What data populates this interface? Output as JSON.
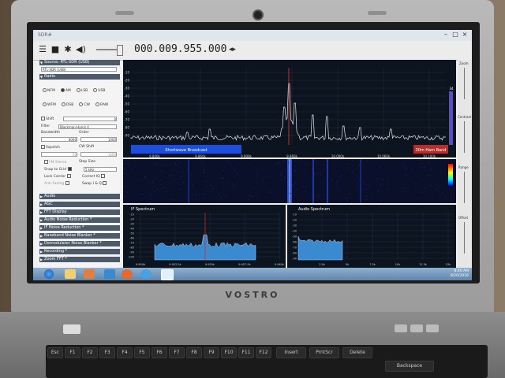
{
  "app": {
    "title": "SDR#"
  },
  "toolbar": {
    "frequency": "000.009.955.000",
    "freq_arrows": "◂▸"
  },
  "source": {
    "header": "Source: RTL-SDR (USB)",
    "device": "RTL-SDR (USB)"
  },
  "radio": {
    "header": "Radio",
    "modes_row1": [
      "NFM",
      "AM",
      "LSB",
      "USB"
    ],
    "modes_row2": [
      "WFM",
      "DSB",
      "CW",
      "RAW"
    ],
    "shift_label": "Shift",
    "shift_value": "0",
    "filter_label": "Filter",
    "filter_value": "Blackman-Harris 4",
    "bandwidth_label": "Bandwidth",
    "order_label": "Order",
    "bandwidth_value": "8000",
    "order_value": "1000",
    "squelch_label": "Squelch",
    "cw_shift_label": "CW Shift",
    "squelch_value": "50",
    "cw_shift_value": "1000",
    "fm_stereo": "FM Stereo",
    "step_size": "Step Size",
    "snap_to_grid": "Snap to Grid",
    "step_value": "5 kHz",
    "lock_carrier": "Lock Carrier",
    "correct_iq": "Correct IQ",
    "anti_fading": "Anti-Fading",
    "swap_iq": "Swap I & Q"
  },
  "panels": [
    "Audio",
    "AGC",
    "FFT Display",
    "Audio Noise Reduction *",
    "IF Noise Reduction *",
    "Baseband Noise Blanker *",
    "Demodulator Noise Blanker *",
    "Recording *",
    "Zoom FFT *"
  ],
  "spectrum": {
    "y_ticks": [
      "-10",
      "-20",
      "-30",
      "-40",
      "-50",
      "-60",
      "-70",
      "-80",
      "-90"
    ],
    "x_ticks": [
      "9.800k",
      "9.860k",
      "9.900k",
      "9.960k",
      "10.000k",
      "10.060k",
      "10.100k"
    ],
    "band_left": "Shortwave Broadcast",
    "band_right": "30m Ham Band",
    "right_value": "34"
  },
  "right_labels": {
    "zoom": "Zoom",
    "contrast": "Contrast",
    "range": "Range",
    "offset": "Offset"
  },
  "if_spectrum": {
    "title": "IF Spectrum",
    "y_ticks": [
      "-10",
      "-20",
      "-30",
      "-40",
      "-50",
      "-60",
      "-70",
      "-80",
      "-90",
      "-100"
    ],
    "x_ticks": [
      "9.950k",
      "9.952.5k",
      "9.955k",
      "9.957.5k",
      "9.960k"
    ]
  },
  "audio_spectrum": {
    "title": "Audio Spectrum",
    "y_ticks": [
      "-10",
      "-20",
      "-30",
      "-40",
      "-50",
      "-60",
      "-70",
      "-80",
      "-90"
    ],
    "x_ticks": [
      "2.5k",
      "5k",
      "7.5k",
      "10k",
      "12.5k",
      "15k"
    ]
  },
  "taskbar": {
    "time": "8:40 AM",
    "date": "8/20/2016"
  },
  "laptop": {
    "brand": "VOSTRO",
    "keys": [
      "Esc",
      "F1",
      "F2",
      "F3",
      "F4",
      "F5",
      "F6",
      "F7",
      "F8",
      "F9",
      "F10",
      "F11",
      "F12",
      "Insert",
      "PrntScr",
      "Delete",
      "Backspace"
    ]
  },
  "colors": {
    "spectrum_bg": "#0c1420",
    "trace": "#e8e8e8",
    "band_blue": "#1d4fd8",
    "band_red": "#b03030",
    "header": "#4f5a68",
    "fill": "#3a8ad0"
  }
}
